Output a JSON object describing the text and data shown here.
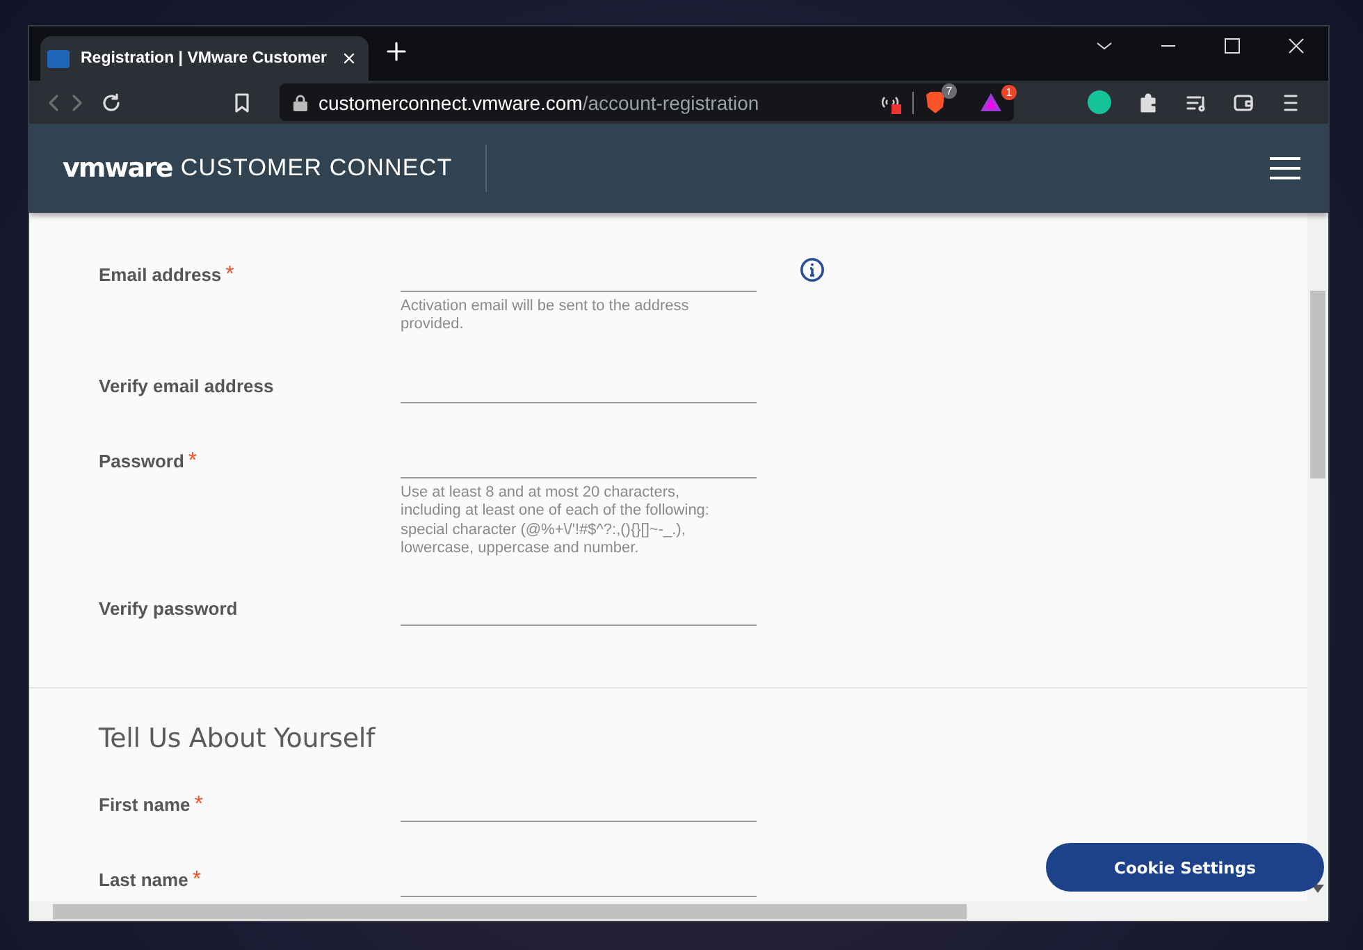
{
  "browser": {
    "tab_title": "Registration | VMware Customer",
    "url_host": "customerconnect.vmware.com",
    "url_path": "/account-registration",
    "shield_count": "7",
    "rewards_count": "1"
  },
  "site": {
    "logo": "vmware",
    "brand": "CUSTOMER CONNECT"
  },
  "sections": [
    {
      "fields": [
        {
          "label": "Email address",
          "required_mark": "*",
          "info": true,
          "hint": "Activation email will be sent to the address provided."
        },
        {
          "label": "Verify email address"
        },
        {
          "label": "Password",
          "required_mark": "*",
          "hint": "Use at least 8 and at most 20 characters, including at least one of each of the following: special character (@%+\\/'!#$^?:,(){}[]~-_.), lowercase, uppercase and number."
        },
        {
          "label": "Verify password"
        }
      ]
    },
    {
      "title": "Tell Us About Yourself",
      "fields": [
        {
          "label": "First name",
          "required_mark": "*"
        },
        {
          "label": "Last name",
          "required_mark": "*"
        }
      ]
    }
  ],
  "cookie_button": "Cookie Settings"
}
